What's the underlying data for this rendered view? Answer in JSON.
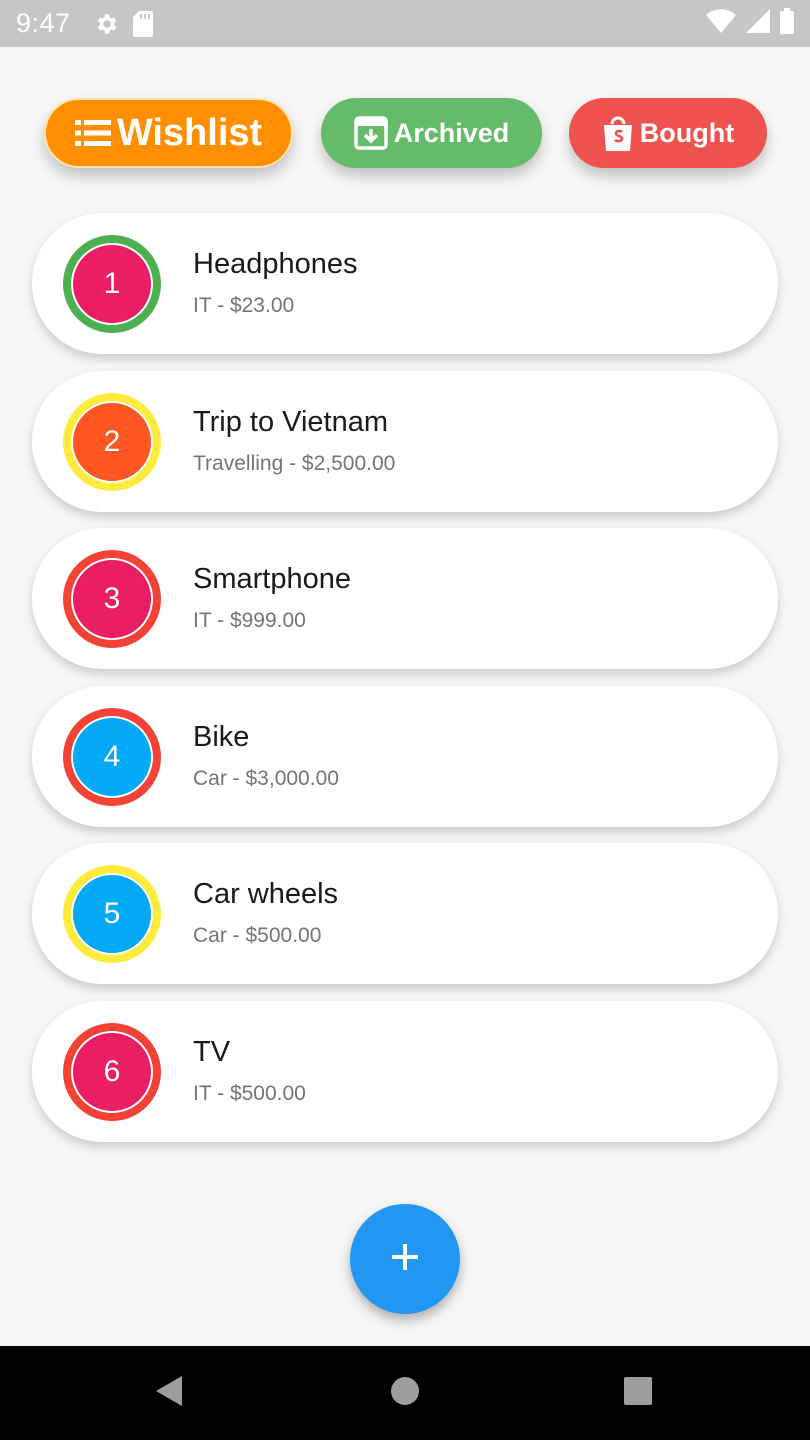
{
  "status_bar": {
    "time": "9:47",
    "left_icons": [
      "gear-icon",
      "sd-card-icon"
    ],
    "right_icons": [
      "wifi-icon",
      "signal-icon",
      "battery-icon"
    ]
  },
  "filters": [
    {
      "label": "Wishlist",
      "icon": "list-icon",
      "color": "#ff8f00",
      "selected": true
    },
    {
      "label": "Archived",
      "icon": "archive-icon",
      "color": "#66bb6a",
      "selected": false
    },
    {
      "label": "Bought",
      "icon": "shopping-bag-icon",
      "color": "#ef5350",
      "selected": false
    }
  ],
  "items": [
    {
      "number": "1",
      "title": "Headphones",
      "subtitle": "IT - $23.00",
      "ring_color": "#4caf50",
      "fill_color": "#e91e63"
    },
    {
      "number": "2",
      "title": "Trip to Vietnam",
      "subtitle": "Travelling - $2,500.00",
      "ring_color": "#ffeb3b",
      "fill_color": "#ff5722"
    },
    {
      "number": "3",
      "title": "Smartphone",
      "subtitle": "IT - $999.00",
      "ring_color": "#f44336",
      "fill_color": "#e91e63"
    },
    {
      "number": "4",
      "title": "Bike",
      "subtitle": "Car - $3,000.00",
      "ring_color": "#f44336",
      "fill_color": "#03a9f4"
    },
    {
      "number": "5",
      "title": "Car wheels",
      "subtitle": "Car - $500.00",
      "ring_color": "#ffeb3b",
      "fill_color": "#03a9f4"
    },
    {
      "number": "6",
      "title": "TV",
      "subtitle": "IT - $500.00",
      "ring_color": "#f44336",
      "fill_color": "#e91e63"
    }
  ],
  "fab": {
    "icon": "plus-icon",
    "color": "#2196f3"
  },
  "nav_bar": {
    "buttons": [
      "back-icon",
      "home-icon",
      "recents-icon"
    ]
  }
}
